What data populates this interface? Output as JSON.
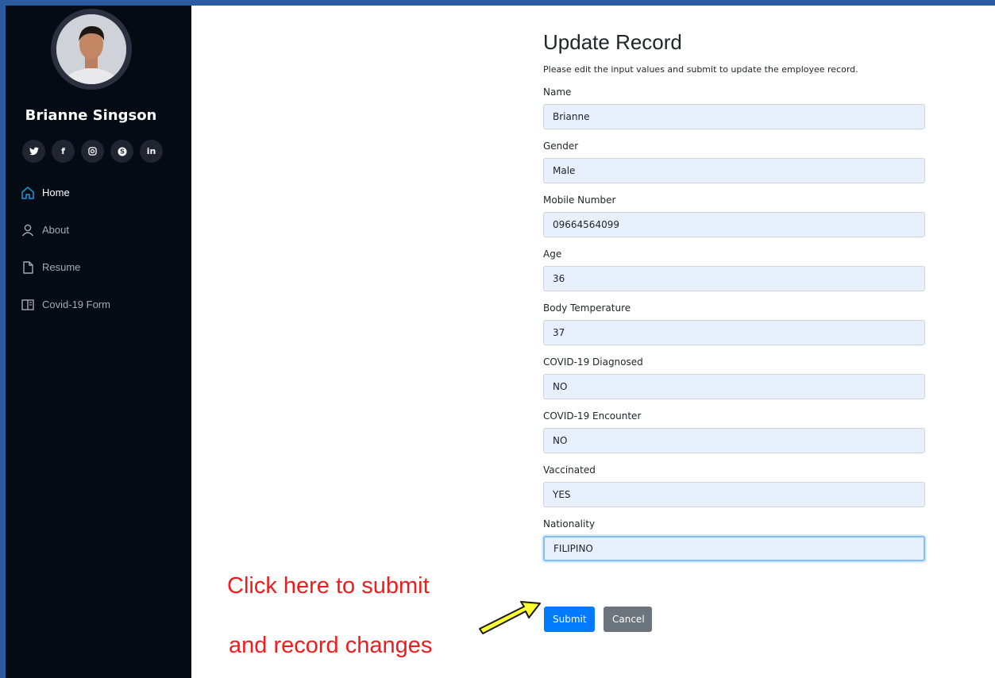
{
  "sidebar": {
    "profile_name": "Brianne Singson",
    "socials": [
      {
        "label": "𝕏",
        "icon": "twitter-icon"
      },
      {
        "label": "f",
        "icon": "facebook-icon"
      },
      {
        "label": "◎",
        "icon": "instagram-icon"
      },
      {
        "label": "S",
        "icon": "skype-icon"
      },
      {
        "label": "in",
        "icon": "linkedin-icon"
      }
    ],
    "nav": [
      {
        "label": "Home",
        "icon": "home-icon",
        "active": true
      },
      {
        "label": "About",
        "icon": "user-icon"
      },
      {
        "label": "Resume",
        "icon": "file-icon"
      },
      {
        "label": "Covid-19 Form",
        "icon": "book-icon"
      }
    ],
    "accent_color": "#149ddd"
  },
  "form": {
    "title": "Update Record",
    "subtitle": "Please edit the input values and submit to update the employee record.",
    "fields": [
      {
        "label": "Name",
        "value": "Brianne"
      },
      {
        "label": "Gender",
        "value": "Male"
      },
      {
        "label": "Mobile Number",
        "value": "09664564099"
      },
      {
        "label": "Age",
        "value": "36"
      },
      {
        "label": "Body Temperature",
        "value": "37"
      },
      {
        "label": "COVID-19 Diagnosed",
        "value": "NO"
      },
      {
        "label": "COVID-19 Encounter",
        "value": "NO"
      },
      {
        "label": "Vaccinated",
        "value": "YES"
      },
      {
        "label": "Nationality",
        "value": "FILIPINO"
      }
    ],
    "submit_label": "Submit",
    "cancel_label": "Cancel"
  },
  "annotation": {
    "line1": "Click here to submit",
    "line2": "and record changes",
    "color": "#ee1c1c",
    "arrow_color": "#ffff33"
  }
}
